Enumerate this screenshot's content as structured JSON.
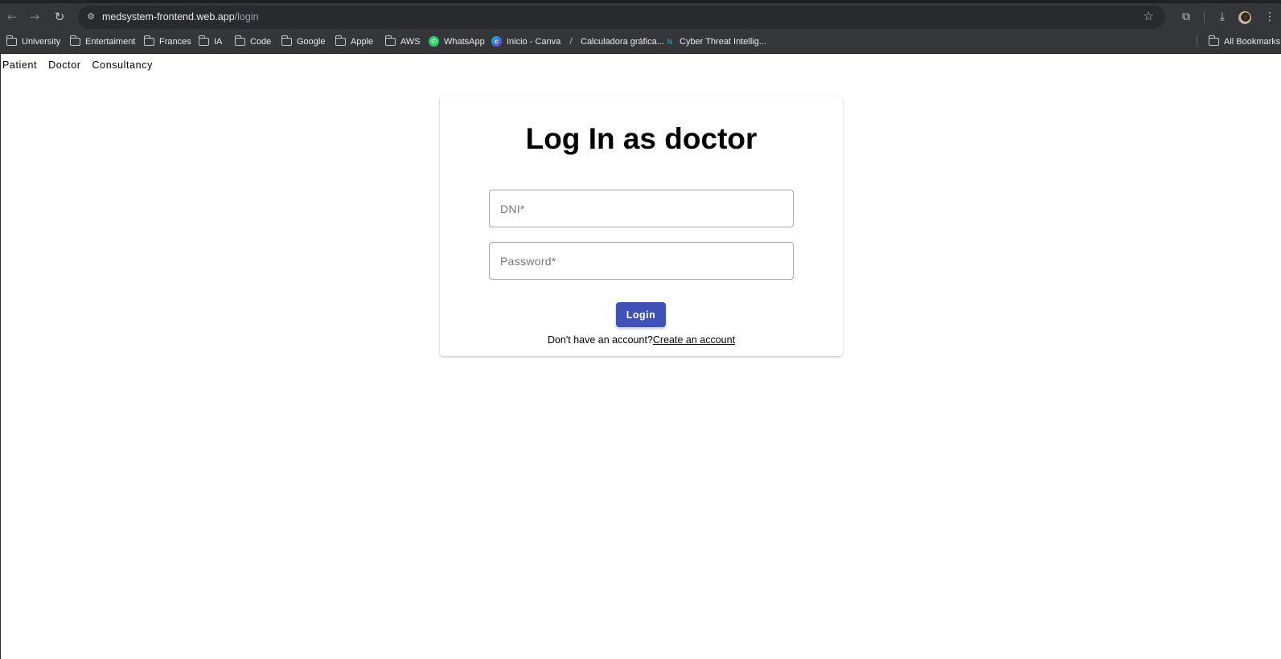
{
  "browser": {
    "url_host": "medsystem-frontend.web.app",
    "url_path": "/login",
    "icons": {
      "back": "back-arrow-icon",
      "forward": "forward-arrow-icon",
      "reload": "reload-icon",
      "site_info": "site-settings-icon",
      "bookmark_star": "star-icon",
      "extensions": "puzzle-piece-icon",
      "downloads": "download-icon",
      "menu": "kebab-menu-icon"
    },
    "bookmarks": [
      {
        "label": "University",
        "icon": "folder"
      },
      {
        "label": "Entertaiment",
        "icon": "folder"
      },
      {
        "label": "Frances",
        "icon": "folder"
      },
      {
        "label": "IA",
        "icon": "folder"
      },
      {
        "label": "Code",
        "icon": "folder"
      },
      {
        "label": "Google",
        "icon": "folder"
      },
      {
        "label": "Apple",
        "icon": "folder"
      },
      {
        "label": "AWS",
        "icon": "folder"
      },
      {
        "label": "WhatsApp",
        "icon": "whatsapp"
      },
      {
        "label": "Inicio - Canva",
        "icon": "canva"
      },
      {
        "label": "Calculadora gráfica...",
        "icon": "calculator"
      },
      {
        "label": "Cyber Threat Intellig...",
        "icon": "cti"
      }
    ],
    "all_bookmarks": "All Bookmarks"
  },
  "nav": {
    "patient": "Patient",
    "doctor": "Doctor",
    "consultancy": "Consultancy"
  },
  "login": {
    "title": "Log In as doctor",
    "dni_placeholder": "DNI*",
    "dni_value": "",
    "password_placeholder": "Password*",
    "password_value": "",
    "button": "Login",
    "signup_prompt": "Don't have an account?",
    "signup_link": "Create an account"
  },
  "colors": {
    "primary": "#3f51b5",
    "chrome": "#35363a",
    "omnibox": "#282a2d"
  }
}
